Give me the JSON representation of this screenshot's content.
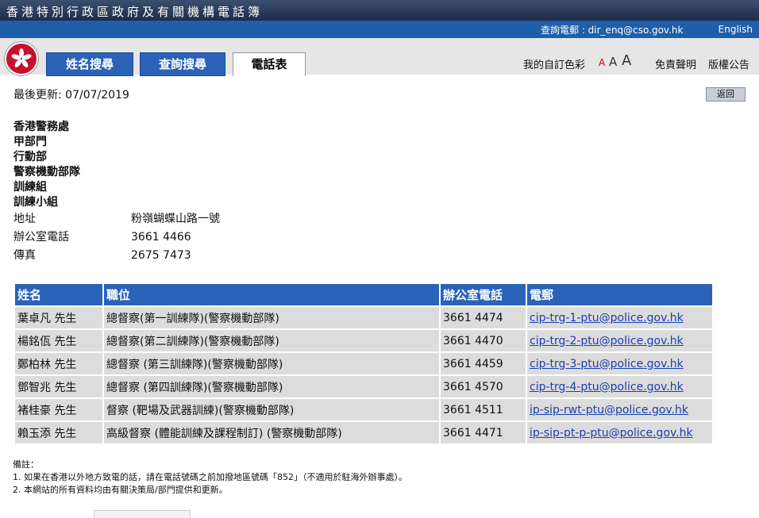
{
  "header": {
    "title": "香港特別行政區政府及有關機構電話簿",
    "enquiry": "查詢電郵 : dir_enq@cso.gov.hk",
    "language": "English"
  },
  "tabs": [
    {
      "label": "姓名搜尋"
    },
    {
      "label": "查詢搜尋"
    },
    {
      "label": "電話表"
    }
  ],
  "toolbar": {
    "custom_color": "我的自訂色彩",
    "font_small": "A",
    "font_medium": "A",
    "font_large": "A",
    "disclaimer": "免責聲明",
    "copyright": "版權公告"
  },
  "page": {
    "last_updated": "最後更新: 07/07/2019",
    "back_label": "返回",
    "hierarchy": [
      "香港警務處",
      "甲部門",
      "行動部",
      "警察機動部隊",
      "訓練組",
      "訓練小組"
    ],
    "address_label": "地址",
    "address_value": "粉嶺蝴蝶山路一號",
    "phone_label": "辦公室電話",
    "phone_value": "3661 4466",
    "fax_label": "傳真",
    "fax_value": "2675 7473"
  },
  "table": {
    "headers": [
      "姓名",
      "職位",
      "辦公室電話",
      "電郵"
    ],
    "rows": [
      [
        "葉卓凡 先生",
        "總督察(第一訓練隊)(警察機動部隊)",
        "3661 4474",
        "cip-trg-1-ptu@police.gov.hk"
      ],
      [
        "楊銘佤 先生",
        "總督察(第二訓練隊)(警察機動部隊)",
        "3661 4470",
        "cip-trg-2-ptu@police.gov.hk"
      ],
      [
        "鄭柏林 先生",
        "總督察 (第三訓練隊)(警察機動部隊)",
        "3661 4459",
        "cip-trg-3-ptu@police.gov.hk"
      ],
      [
        "鄧智兆 先生",
        "總督察 (第四訓練隊)(警察機動部隊)",
        "3661 4570",
        "cip-trg-4-ptu@police.gov.hk"
      ],
      [
        "褚桂豪 先生",
        "督察 (靶場及武器訓練)(警察機動部隊)",
        "3661 4511",
        "ip-sip-rwt-ptu@police.gov.hk"
      ],
      [
        "賴玉添 先生",
        "高級督察 (體能訓練及課程制訂) (警察機動部隊)",
        "3661 4471",
        "ip-sip-pt-p-ptu@police.gov.hk"
      ]
    ]
  },
  "notes": {
    "heading": "備註：",
    "items": [
      "1. 如果在香港以外地方致電的話，請在電話號碼之前加撥地區號碼「852」（不適用於駐海外辦事處）。",
      "2. 本網站的所有資料均由有關決策局/部門提供和更新。"
    ]
  }
}
